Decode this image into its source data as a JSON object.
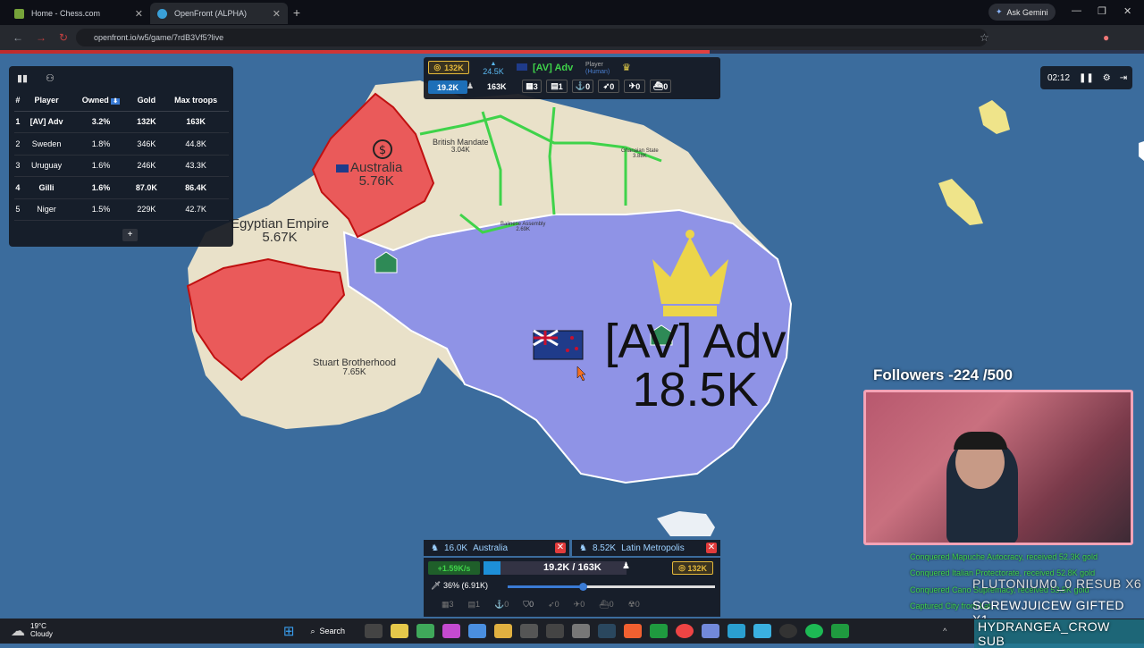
{
  "browser": {
    "tabs": [
      {
        "label": "Home - Chess.com",
        "color": "#76a33a",
        "active": false
      },
      {
        "label": "OpenFront (ALPHA)",
        "color": "#3aa0d8",
        "active": true
      }
    ],
    "url": "openfront.io/w5/game/7rdB3Vf5?live",
    "ask_gemini": "Ask Gemini"
  },
  "leaderboard": {
    "headers": [
      "#",
      "Player",
      "Owned",
      "Gold",
      "Max troops"
    ],
    "rows": [
      {
        "rank": "1",
        "player": "[AV] Adv",
        "owned": "3.2%",
        "gold": "132K",
        "troops": "163K",
        "bold": true
      },
      {
        "rank": "2",
        "player": "Sweden",
        "owned": "1.8%",
        "gold": "346K",
        "troops": "44.8K",
        "bold": false
      },
      {
        "rank": "3",
        "player": "Uruguay",
        "owned": "1.6%",
        "gold": "246K",
        "troops": "43.3K",
        "bold": false
      },
      {
        "rank": "4",
        "player": "Gilli",
        "owned": "1.6%",
        "gold": "87.0K",
        "troops": "86.4K",
        "bold": true
      },
      {
        "rank": "5",
        "player": "Niger",
        "owned": "1.5%",
        "gold": "229K",
        "troops": "42.7K",
        "bold": false
      }
    ],
    "add_label": "+"
  },
  "stats": {
    "gold": "132K",
    "troop_rate": "24.5K",
    "troops": "19.2K",
    "max_troops": "163K",
    "player_name": "[AV] Adv",
    "player_type": "Player",
    "player_sub": "(Human)",
    "counts": [
      "3",
      "1",
      "0",
      "0",
      "0",
      "0"
    ]
  },
  "timer": {
    "time": "02:12"
  },
  "map_labels": {
    "australia": {
      "name": "Australia",
      "troops": "5.76K"
    },
    "egypt": {
      "name": "Egyptian Empire",
      "troops": "5.67K"
    },
    "british": {
      "name": "British Mandate",
      "troops": "3.04K"
    },
    "ghanaian": {
      "name": "Ghanaian State",
      "troops": "3.88K"
    },
    "balinese": {
      "name": "Balinese Assembly",
      "troops": "2.69K"
    },
    "stuart": {
      "name": "Stuart Brotherhood",
      "troops": "7.65K"
    },
    "player": {
      "name": "[AV] Adv",
      "troops": "18.5K"
    }
  },
  "attacks": [
    {
      "troops": "16.0K",
      "target": "Australia"
    },
    {
      "troops": "8.52K",
      "target": "Latin Metropolis"
    }
  ],
  "controls": {
    "rate": "+1.59K/s",
    "troop_ratio": "19.2K / 163K",
    "gold": "132K",
    "attack_ratio": "36% (6.91K)",
    "attack_ratio_value": 0.36,
    "troop_fill": 0.118,
    "build_counts": [
      "3",
      "1",
      "0",
      "0",
      "0",
      "0",
      "0",
      "0"
    ]
  },
  "stream": {
    "followers": "Followers -224 /500",
    "feed": [
      "Conquered Mapuche Autocracy, received 52.3K gold",
      "Conquered Italian Protectorate, received 52.8K gold",
      "Conquered Cano Supremacy, received 53.5K gold",
      "Captured City from Lat..."
    ],
    "alerts": [
      "PLUTONIUM0_0  RESUB X6",
      "SCREWJUICEW  GIFTED X1",
      "HYDRANGEA_CROW  SUB"
    ]
  },
  "weather": {
    "temp": "19°C",
    "cond": "Cloudy"
  },
  "taskbar": {
    "search": "Search"
  },
  "colors": {
    "panel": "#141821",
    "accent_green": "#3fd34a",
    "gold": "#e5b93a",
    "red_territory": "#ea5a5a",
    "player_territory": "#8f93e6"
  }
}
